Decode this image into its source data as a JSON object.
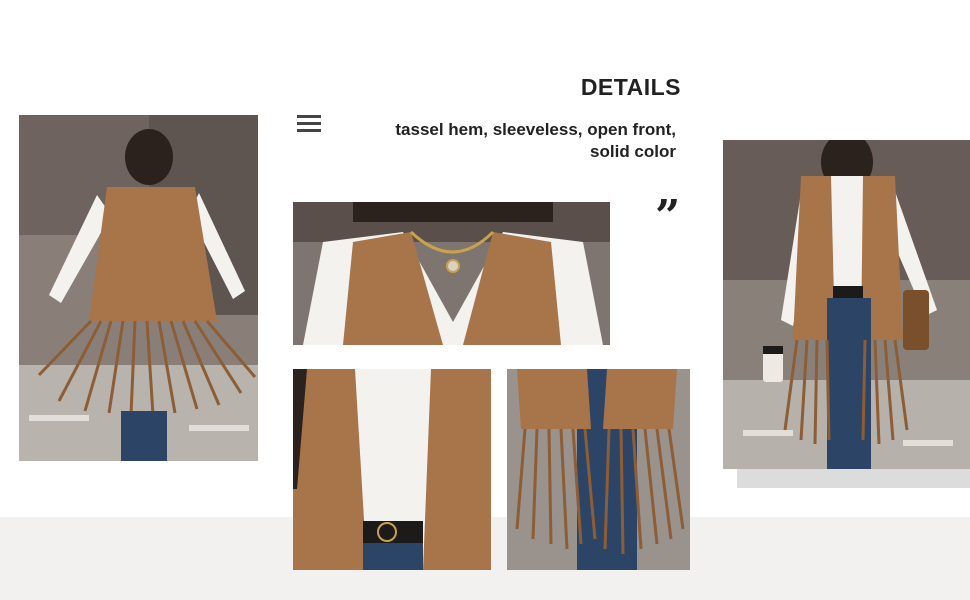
{
  "details": {
    "title": "DETAILS",
    "description": "tassel hem, sleeveless, open front, solid color"
  },
  "icons": {
    "menu": "menu-icon",
    "quote": "quote-icon",
    "quote_glyph": "”"
  },
  "photos": [
    {
      "name": "model-back-view",
      "subject": "woman in tan fringe vest, back view, street"
    },
    {
      "name": "neckline-crop",
      "subject": "close-up of vest neckline with chain necklace"
    },
    {
      "name": "front-crop",
      "subject": "close-up of vest front with belt"
    },
    {
      "name": "fringe-crop",
      "subject": "close-up of tassel hem over jeans"
    },
    {
      "name": "model-front-view",
      "subject": "woman in tan fringe vest holding cup, front view"
    }
  ],
  "colors": {
    "suede": "#a8744a",
    "suede_dark": "#7a4f2c",
    "shirt": "#f4f2ee",
    "denim": "#2c4466",
    "band": "#f2f1ef"
  }
}
